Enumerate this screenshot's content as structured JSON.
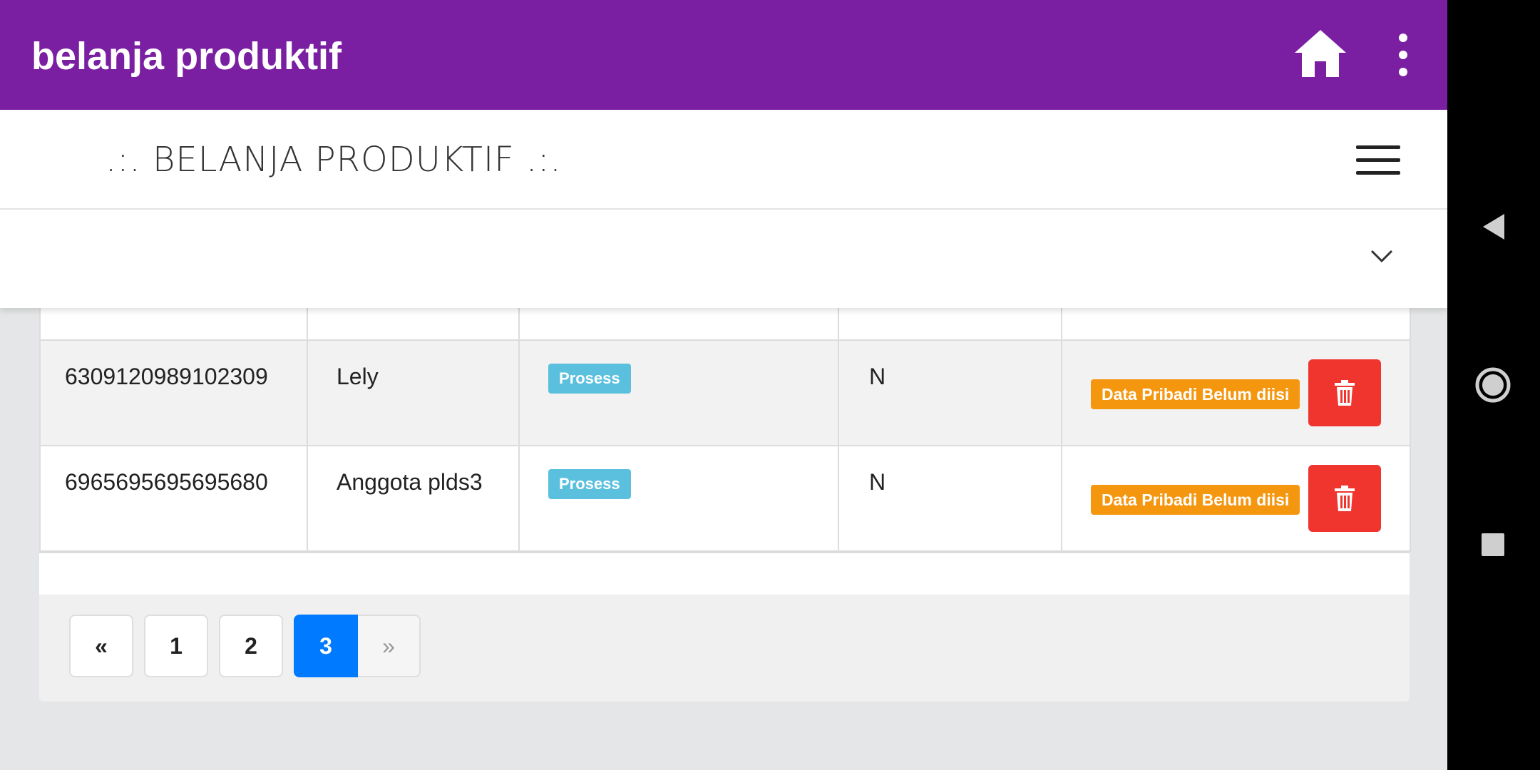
{
  "appbar": {
    "title": "belanja produktif",
    "home_icon": "home-icon",
    "more_icon": "more-vert-icon"
  },
  "navbar": {
    "brand": ".:. BELANJA PRODUKTIF .:.",
    "menu_icon": "hamburger-icon"
  },
  "dropdown": {
    "icon": "chevron-down-icon"
  },
  "table": {
    "rows": [
      {
        "id": "6309120989102309",
        "nama": "Lely",
        "status": "Prosess",
        "flag": "N",
        "note": "Data Pribadi Belum diisi"
      },
      {
        "id": "6965695695695680",
        "nama": "Anggota plds3",
        "status": "Prosess",
        "flag": "N",
        "note": "Data Pribadi Belum diisi"
      }
    ]
  },
  "pagination": {
    "prev": "«",
    "pages": [
      "1",
      "2",
      "3"
    ],
    "active": "3",
    "next": "»"
  },
  "colors": {
    "appbar": "#7b1fa2",
    "badge_info": "#5bc0de",
    "badge_warning": "#f5960f",
    "danger": "#f0352e",
    "primary": "#007bff"
  },
  "android_nav": {
    "back": "back-icon",
    "home": "home-circle-icon",
    "recents": "recents-icon"
  }
}
